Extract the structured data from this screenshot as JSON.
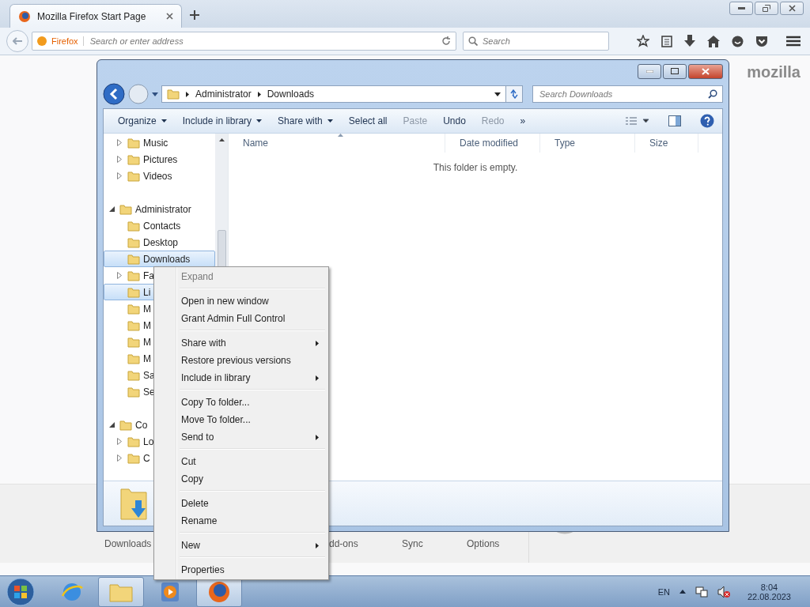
{
  "browser": {
    "tab": {
      "title": "Mozilla Firefox Start Page"
    },
    "identity": "Firefox",
    "address": {
      "placeholder": "Search or enter address"
    },
    "search": {
      "placeholder": "Search"
    }
  },
  "start_page": {
    "logo": "mozilla",
    "launcher": [
      "Downloads",
      "dd-ons",
      "Sync",
      "Options"
    ]
  },
  "explorer": {
    "path": [
      "Administrator",
      "Downloads"
    ],
    "search": {
      "placeholder": "Search Downloads"
    },
    "toolbar": [
      {
        "label": "Organize",
        "dropdown": true,
        "disabled": false
      },
      {
        "label": "Include in library",
        "dropdown": true,
        "disabled": false
      },
      {
        "label": "Share with",
        "dropdown": true,
        "disabled": false
      },
      {
        "label": "Select all",
        "dropdown": false,
        "disabled": false
      },
      {
        "label": "Paste",
        "dropdown": false,
        "disabled": true
      },
      {
        "label": "Undo",
        "dropdown": false,
        "disabled": false
      },
      {
        "label": "Redo",
        "dropdown": false,
        "disabled": true
      },
      {
        "label": "»",
        "dropdown": false,
        "disabled": false
      }
    ],
    "tree": [
      {
        "kind": "continued",
        "items": [
          {
            "label": "Music",
            "expanded": false,
            "selected": false
          },
          {
            "label": "Pictures",
            "expanded": false,
            "selected": false
          },
          {
            "label": "Videos",
            "expanded": false,
            "selected": false
          }
        ]
      },
      {
        "kind": "root",
        "items": [
          {
            "label": "Administrator",
            "expanded": true,
            "selected": false,
            "children": [
              {
                "label": "Contacts",
                "selected": false
              },
              {
                "label": "Desktop",
                "selected": false
              },
              {
                "label": "Downloads",
                "selected": true
              },
              {
                "label": "Fa",
                "expanded": false,
                "selected": false
              },
              {
                "label": "Li",
                "selected": true
              },
              {
                "label": "M",
                "selected": false
              },
              {
                "label": "M",
                "selected": false
              },
              {
                "label": "M",
                "selected": false
              },
              {
                "label": "M",
                "selected": false
              },
              {
                "label": "Sa",
                "selected": false
              },
              {
                "label": "Se",
                "selected": false
              }
            ]
          }
        ]
      },
      {
        "kind": "root",
        "items": [
          {
            "label": "Co",
            "expanded": true,
            "selected": false,
            "children": [
              {
                "label": "Lo",
                "expanded": false,
                "selected": false
              },
              {
                "label": "C",
                "expanded": false,
                "selected": false
              }
            ]
          }
        ]
      }
    ],
    "columns": [
      "Name",
      "Date modified",
      "Type",
      "Size"
    ],
    "empty_message": "This folder is empty."
  },
  "context_menu": [
    {
      "kind": "item",
      "label": "Expand",
      "disabled": true,
      "submenu": false
    },
    {
      "kind": "separator"
    },
    {
      "kind": "item",
      "label": "Open in new window",
      "disabled": false,
      "submenu": false
    },
    {
      "kind": "item",
      "label": "Grant Admin Full Control",
      "disabled": false,
      "submenu": false
    },
    {
      "kind": "separator"
    },
    {
      "kind": "item",
      "label": "Share with",
      "disabled": false,
      "submenu": true
    },
    {
      "kind": "item",
      "label": "Restore previous versions",
      "disabled": false,
      "submenu": false
    },
    {
      "kind": "item",
      "label": "Include in library",
      "disabled": false,
      "submenu": true
    },
    {
      "kind": "separator"
    },
    {
      "kind": "item",
      "label": "Copy To folder...",
      "disabled": false,
      "submenu": false
    },
    {
      "kind": "item",
      "label": "Move To folder...",
      "disabled": false,
      "submenu": false
    },
    {
      "kind": "item",
      "label": "Send to",
      "disabled": false,
      "submenu": true
    },
    {
      "kind": "separator"
    },
    {
      "kind": "item",
      "label": "Cut",
      "disabled": false,
      "submenu": false
    },
    {
      "kind": "item",
      "label": "Copy",
      "disabled": false,
      "submenu": false
    },
    {
      "kind": "separator"
    },
    {
      "kind": "item",
      "label": "Delete",
      "disabled": false,
      "submenu": false
    },
    {
      "kind": "item",
      "label": "Rename",
      "disabled": false,
      "submenu": false
    },
    {
      "kind": "separator"
    },
    {
      "kind": "item",
      "label": "New",
      "disabled": false,
      "submenu": true
    },
    {
      "kind": "separator"
    },
    {
      "kind": "item",
      "label": "Properties",
      "disabled": false,
      "submenu": false
    }
  ],
  "taskbar": {
    "apps": [
      {
        "kind": "globe",
        "selected": false
      },
      {
        "kind": "folder",
        "selected": true
      },
      {
        "kind": "player",
        "selected": false
      },
      {
        "kind": "firefox",
        "selected": true
      }
    ],
    "language": "EN",
    "time": "8:04",
    "date": "22.08.2023"
  }
}
